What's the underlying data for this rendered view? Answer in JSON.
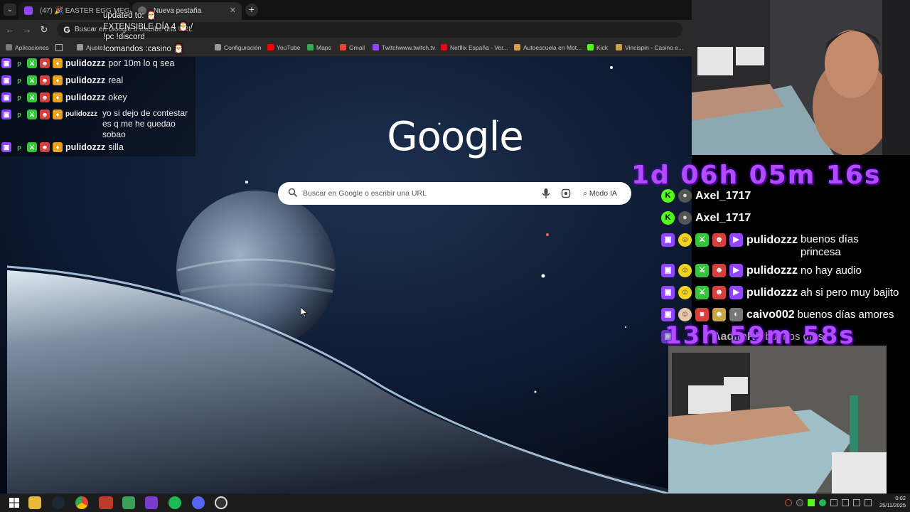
{
  "browser": {
    "tab_menu_glyph": "⌄",
    "tabs": [
      {
        "label": "(47) 🎉 EASTER EGG MEGA",
        "close": "✕"
      },
      {
        "label": "Nueva pestaña",
        "close": "✕"
      }
    ],
    "new_tab_glyph": "+",
    "nav": {
      "back": "←",
      "forward": "→",
      "reload": "↻"
    },
    "omnibox_text": "Buscar en Google o escribir una URL",
    "omnibox_icon": "G",
    "bookmarks": [
      {
        "label": "Aplicaciones",
        "color": "#7b7b7b"
      },
      {
        "label": "Ajustes",
        "color": "#9a9a9a"
      },
      {
        "label": "Configuración",
        "color": "#9a9a9a"
      },
      {
        "label": "YouTube",
        "color": "#ff0000"
      },
      {
        "label": "Maps",
        "color": "#34a853"
      },
      {
        "label": "Gmail",
        "color": "#ea4335"
      },
      {
        "label": "Twitchwww.twitch.tv",
        "color": "#9147ff"
      },
      {
        "label": "Netflix España - Ver...",
        "color": "#e50914"
      },
      {
        "label": "Autoescuela en Mot...",
        "color": "#d8a040"
      },
      {
        "label": "Kick",
        "color": "#53fc18"
      },
      {
        "label": "Vincispin - Casino e...",
        "color": "#caa24b"
      }
    ]
  },
  "newtab": {
    "logo": "Google",
    "search_placeholder": "Buscar en Google o escribir una URL",
    "ai_mode_label": "Modo IA"
  },
  "stream_overlay": {
    "updated_lines": [
      "updated to: 🎅",
      "EXTENSIBLE DÍA 4 🎅 /",
      "!pc !discord",
      "!comandos :casino 🎅"
    ],
    "timer_top": "1d 06h 05m 16s",
    "timer_bottom": "13h 59m 58s"
  },
  "chat_left": [
    {
      "user": "pulidozzz",
      "message": "por 10m lo q sea"
    },
    {
      "user": "pulidozzz",
      "message": "real"
    },
    {
      "user": "pulidozzz",
      "message": "okey"
    },
    {
      "user": "pulidozzz",
      "message": "yo si dejo de contestar es q me he quedao sobao"
    },
    {
      "user": "pulidozzz",
      "message": "silla"
    }
  ],
  "chat_right": [
    {
      "user": "Axel_1717",
      "message": "",
      "platform": "kick"
    },
    {
      "user": "Axel_1717",
      "message": "",
      "platform": "kick"
    },
    {
      "user": "pulidozzz",
      "message": "buenos días princesa",
      "platform": "twitch"
    },
    {
      "user": "pulidozzz",
      "message": "no hay audio",
      "platform": "twitch"
    },
    {
      "user": "pulidozzz",
      "message": "ah si pero muy bajito",
      "platform": "twitch"
    },
    {
      "user": "caivo002",
      "message": "buenos días amores",
      "platform": "twitch"
    },
    {
      "user": "AadimRL",
      "message": "buenos días",
      "platform": "twitch"
    }
  ],
  "taskbar": {
    "clock_time": "0:02",
    "clock_date": "25/11/2025",
    "apps": [
      "start",
      "explorer",
      "steam",
      "chrome",
      "stream-deck",
      "xbox",
      "game-app",
      "spotify",
      "discord",
      "obs"
    ]
  }
}
